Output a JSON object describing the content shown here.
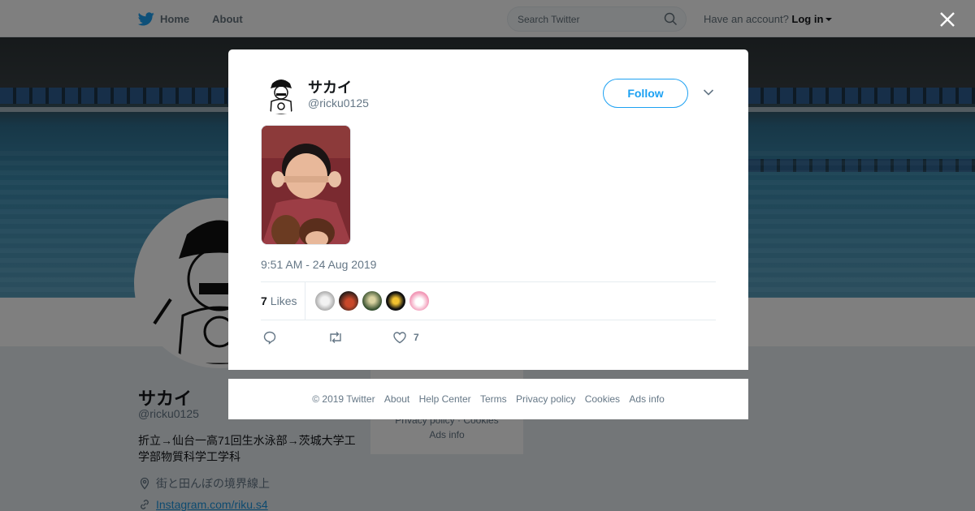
{
  "nav": {
    "home": "Home",
    "about": "About"
  },
  "search": {
    "placeholder": "Search Twitter"
  },
  "account": {
    "prompt": "Have an account?",
    "login": "Log in"
  },
  "profile": {
    "name": "サカイ",
    "handle": "@ricku0125",
    "bio": "折立→仙台一高71回生水泳部→茨城大学工学部物質科学工学科",
    "location": "街と田んぼの境界線上",
    "url": "Instagram.com/riku.s4"
  },
  "side_footer": {
    "privacy": "Privacy policy",
    "cookies": "Cookies",
    "ads": "Ads info"
  },
  "tweet": {
    "name": "サカイ",
    "handle": "@ricku0125",
    "follow_label": "Follow",
    "timestamp": "9:51 AM - 24 Aug 2019",
    "likes_count": "7",
    "likes_label": "Likes",
    "like_action_count": "7"
  },
  "footer": {
    "copyright": "© 2019 Twitter",
    "about": "About",
    "help": "Help Center",
    "terms": "Terms",
    "privacy": "Privacy policy",
    "cookies": "Cookies",
    "ads": "Ads info"
  },
  "colors": {
    "brand": "#1da1f2",
    "link": "#1b95e0",
    "muted": "#657786"
  }
}
